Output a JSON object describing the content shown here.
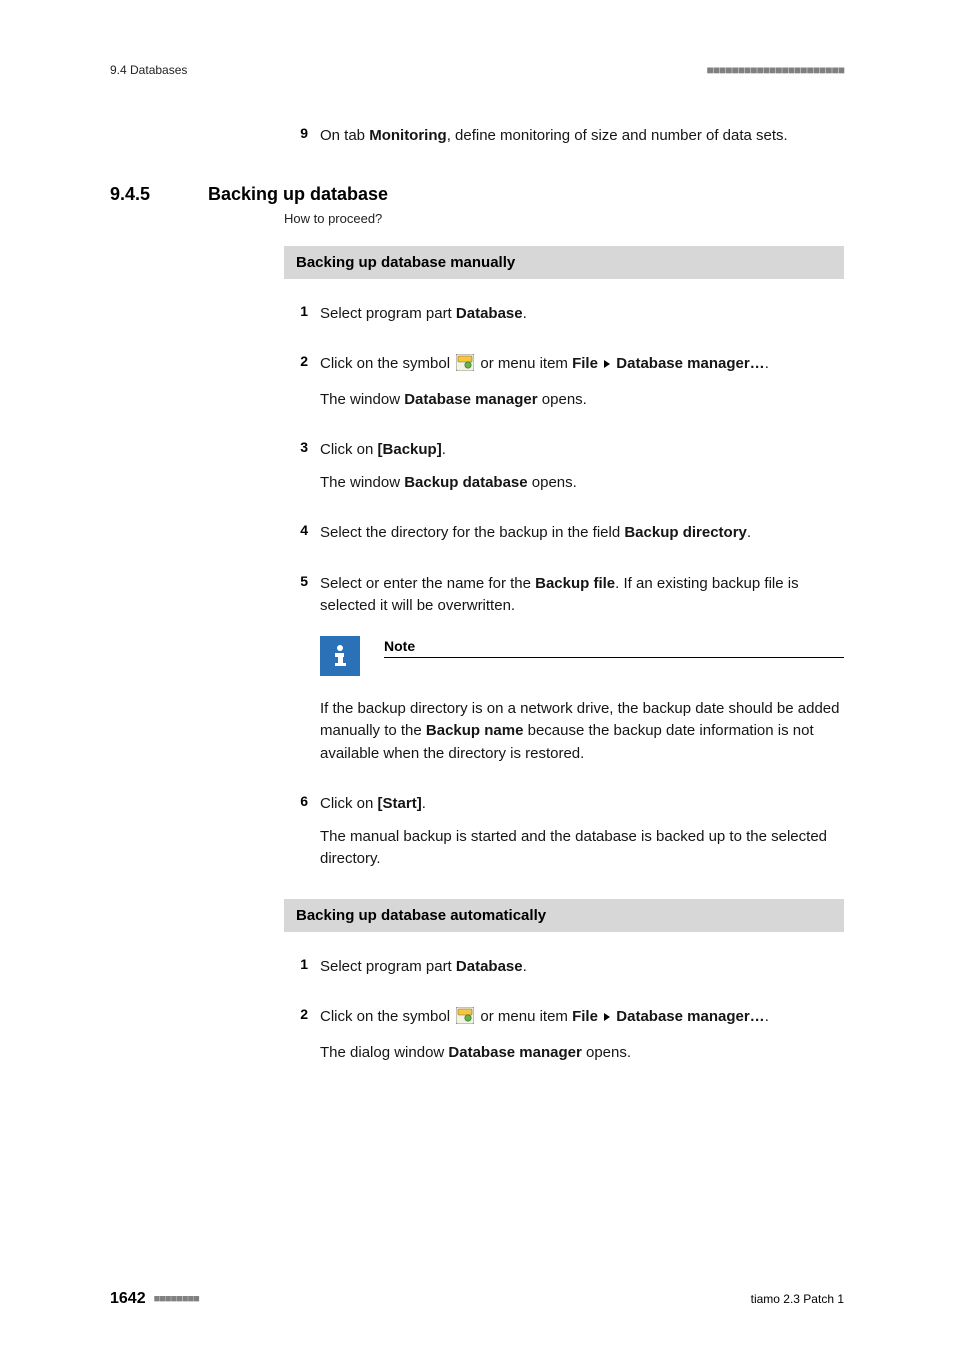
{
  "header": {
    "left": "9.4 Databases"
  },
  "intro_step": {
    "num": "9",
    "text_before": "On tab ",
    "bold": "Monitoring",
    "text_after": ", define monitoring of size and number of data sets."
  },
  "section": {
    "num": "9.4.5",
    "title": "Backing up database",
    "subtitle": "How to proceed?"
  },
  "manual": {
    "bar": "Backing up database manually",
    "s1": {
      "num": "1",
      "a": "Select program part ",
      "b": "Database",
      "c": "."
    },
    "s2": {
      "num": "2",
      "a": "Click on the symbol ",
      "b": " or menu item ",
      "c": "File",
      "d": "Database manager…",
      "e": ".",
      "sub_a": "The window ",
      "sub_b": "Database manager",
      "sub_c": " opens."
    },
    "s3": {
      "num": "3",
      "a": "Click on ",
      "b": "[Backup]",
      "c": ".",
      "sub_a": "The window ",
      "sub_b": "Backup database",
      "sub_c": " opens."
    },
    "s4": {
      "num": "4",
      "a": "Select the directory for the backup in the field ",
      "b": "Backup directory",
      "c": "."
    },
    "s5": {
      "num": "5",
      "a": "Select or enter the name for the ",
      "b": "Backup file",
      "c": ". If an existing backup file is selected it will be overwritten."
    },
    "note": {
      "title": "Note",
      "a": "If the backup directory is on a network drive, the backup date should be added manually to the ",
      "b": "Backup name",
      "c": " because the backup date information is not available when the directory is restored."
    },
    "s6": {
      "num": "6",
      "a": "Click on ",
      "b": "[Start]",
      "c": ".",
      "sub": "The manual backup is started and the database is backed up to the selected directory."
    }
  },
  "auto": {
    "bar": "Backing up database automatically",
    "s1": {
      "num": "1",
      "a": "Select program part ",
      "b": "Database",
      "c": "."
    },
    "s2": {
      "num": "2",
      "a": "Click on the symbol ",
      "b": " or menu item ",
      "c": "File",
      "d": "Database manager…",
      "e": ".",
      "sub_a": "The dialog window ",
      "sub_b": "Database manager",
      "sub_c": " opens."
    }
  },
  "footer": {
    "page": "1642",
    "right": "tiamo 2.3 Patch 1"
  }
}
